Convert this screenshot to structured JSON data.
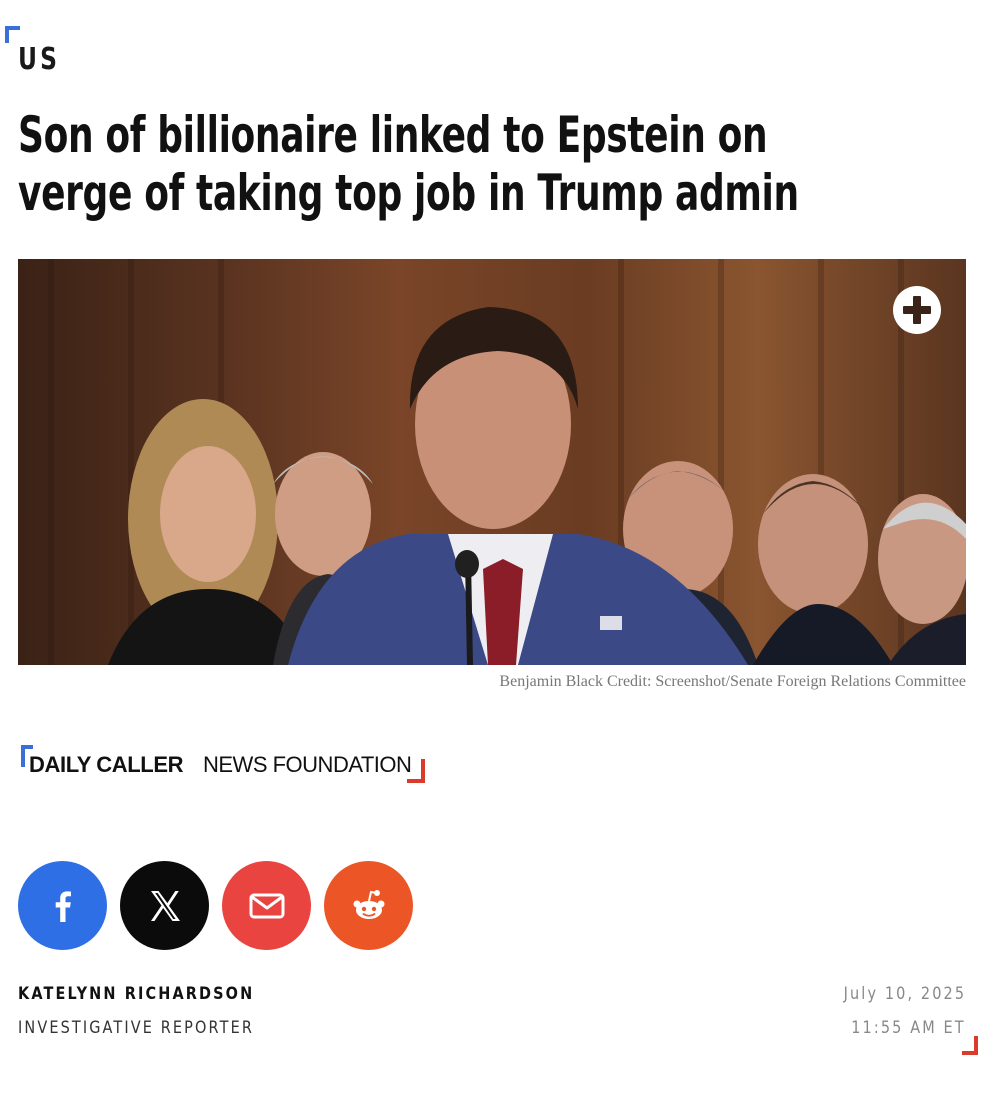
{
  "section": {
    "label": "US"
  },
  "article": {
    "headline": "Son of billionaire linked to Epstein on verge of taking top job in Trump admin",
    "image": {
      "alt": "Man in blue suit speaking at a Senate hearing with onlookers behind him",
      "caption": "Benjamin Black Credit: Screenshot/Senate Foreign Relations Committee",
      "expand_icon": "plus-circle-icon"
    }
  },
  "publisher_logo": {
    "bold": "DAILY CALLER",
    "regular": "NEWS FOUNDATION"
  },
  "share": {
    "buttons": [
      {
        "name": "facebook",
        "icon": "facebook-icon",
        "color": "#2f6fe6"
      },
      {
        "name": "x",
        "icon": "x-icon",
        "color": "#0b0b0b"
      },
      {
        "name": "email",
        "icon": "mail-icon",
        "color": "#e94440"
      },
      {
        "name": "reddit",
        "icon": "reddit-icon",
        "color": "#ec5626"
      }
    ]
  },
  "byline": {
    "author": "KATELYNN RICHARDSON",
    "role": "INVESTIGATIVE REPORTER",
    "date": "July 10, 2025",
    "time": "11:55 AM ET"
  },
  "colors": {
    "accent_blue": "#3a6fd8",
    "accent_red": "#d93b2c"
  }
}
